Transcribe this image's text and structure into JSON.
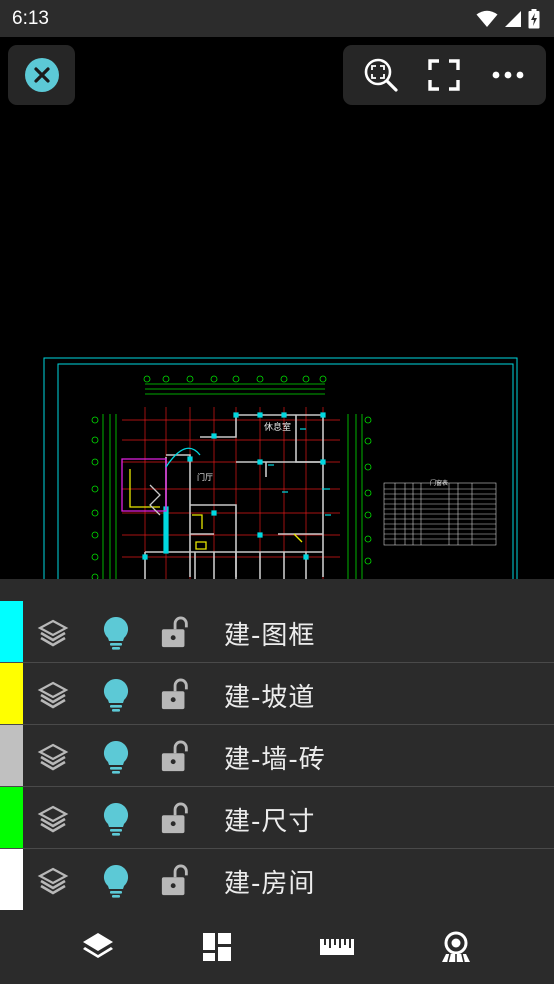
{
  "status_bar": {
    "time": "6:13",
    "icons": [
      "wifi-icon",
      "signal-icon",
      "battery-icon"
    ]
  },
  "top_bar": {
    "close_icon": "close-icon",
    "tools": [
      "zoom-fit-icon",
      "fullscreen-icon",
      "more-icon"
    ]
  },
  "drawing": {
    "label_room_top": "休息室",
    "label_hall": "门厅",
    "label_table_title": "门窗表"
  },
  "layers": [
    {
      "name": "建-图框",
      "color": "#00ffff"
    },
    {
      "name": "建-坡道",
      "color": "#ffff00"
    },
    {
      "name": "建-墙-砖",
      "color": "#c0c0c0"
    },
    {
      "name": "建-尺寸",
      "color": "#00ff00"
    },
    {
      "name": "建-房间",
      "color": "#ffffff"
    }
  ],
  "bottom_nav": [
    "layers-icon",
    "layout-icon",
    "ruler-icon",
    "view-icon"
  ],
  "colors": {
    "accent": "#5cc9d6",
    "panel_bg": "#2b2b2b",
    "icon_gray": "#b8b8b8"
  }
}
